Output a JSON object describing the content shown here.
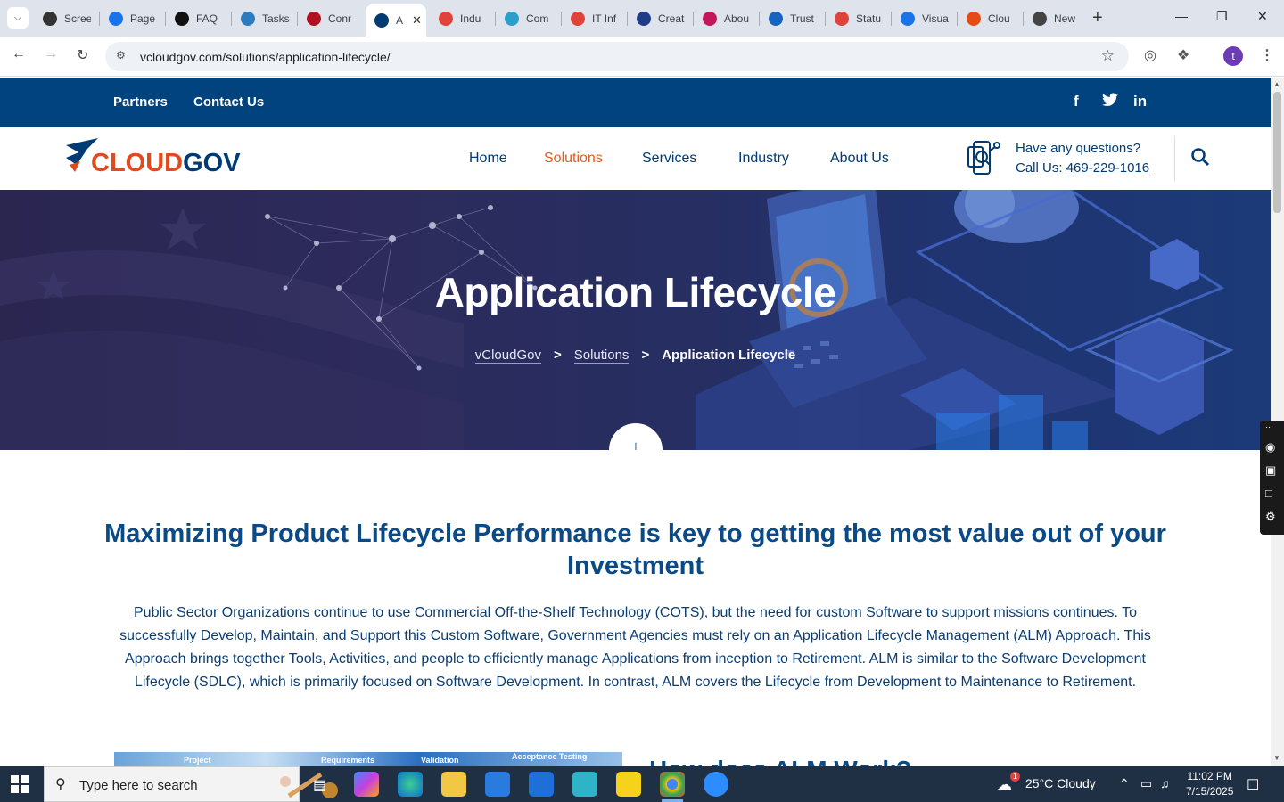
{
  "browser": {
    "tabs": [
      {
        "title": "Scree",
        "color": "#333"
      },
      {
        "title": "Page",
        "color": "#1a73e8"
      },
      {
        "title": "FAQ",
        "color": "#111"
      },
      {
        "title": "Tasks",
        "color": "#2a7bbf"
      },
      {
        "title": "Conr",
        "color": "#b01020"
      },
      {
        "title": "A",
        "color": "#003b73"
      },
      {
        "title": "Indu",
        "color": "#e0433a"
      },
      {
        "title": "Com",
        "color": "#2a9fc9"
      },
      {
        "title": "IT Inf",
        "color": "#e0433a"
      },
      {
        "title": "Creat",
        "color": "#1f3c88"
      },
      {
        "title": "Abou",
        "color": "#c2185b"
      },
      {
        "title": "Trust",
        "color": "#1565c0"
      },
      {
        "title": "Statu",
        "color": "#e0433a"
      },
      {
        "title": "Visua",
        "color": "#1a73e8"
      },
      {
        "title": "Clou",
        "color": "#e64a19"
      },
      {
        "title": "New",
        "color": "#444"
      }
    ],
    "url": "vcloudgov.com/solutions/application-lifecycle/",
    "profile_initial": "t"
  },
  "site": {
    "topbar": {
      "links": [
        "Partners",
        "Contact Us"
      ],
      "social": [
        "facebook-icon",
        "twitter-icon",
        "linkedin-icon"
      ]
    },
    "logo": {
      "part1": "CLOUD",
      "part2": "GOV",
      "brand_red": "#e04a1e",
      "brand_blue": "#003b73"
    },
    "nav": [
      "Home",
      "Solutions",
      "Services",
      "Industry",
      "About Us"
    ],
    "nav_active": "Solutions",
    "contact": {
      "line1": "Have any questions?",
      "line2_prefix": "Call Us: ",
      "phone": "469-229-1016"
    },
    "hero": {
      "title": "Application Lifecycle",
      "breadcrumb": [
        "vCloudGov",
        "Solutions",
        "Application Lifecycle"
      ],
      "separator": ">"
    },
    "content": {
      "heading": "Maximizing Product Lifecycle Performance is key to getting the most value out of your Investment",
      "paragraph": "Public Sector Organizations continue to use Commercial Off-the-Shelf Technology (COTS), but the need for custom Software to support missions continues. To successfully Develop, Maintain, and Support this Custom Software, Government Agencies must rely on an Application Lifecycle Management (ALM) Approach. This Approach brings together Tools, Activities, and people to efficiently manage Applications from inception to Retirement. ALM is similar to the Software Development Lifecycle (SDLC), which is primarily focused on Software Development. In contrast, ALM covers the Lifecycle from Development to Maintenance to Retirement.",
      "diagram_labels": [
        "Project",
        "Requirements",
        "Validation",
        "Acceptance Testing"
      ],
      "next_heading": "How does ALM Work?"
    }
  },
  "taskbar": {
    "search_placeholder": "Type here to search",
    "weather": "25°C  Cloudy",
    "weather_badge": "1",
    "time": "11:02 PM",
    "date": "7/15/2025"
  }
}
